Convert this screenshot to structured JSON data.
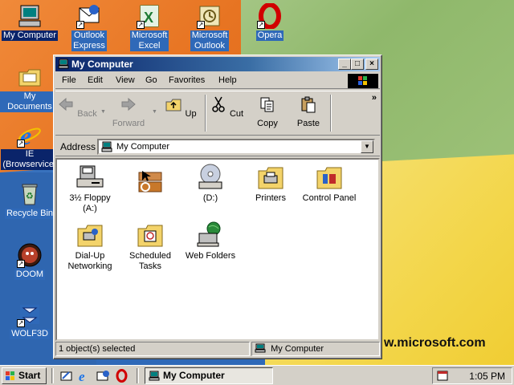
{
  "desktop": {
    "icons": [
      {
        "label": "My Computer"
      },
      {
        "label": "Outlook\nExpress"
      },
      {
        "label": "Microsoft\nExcel"
      },
      {
        "label": "Microsoft\nOutlook"
      },
      {
        "label": "Opera"
      },
      {
        "label": "My Documents"
      },
      {
        "label": "IE\n(Browservice)"
      },
      {
        "label": "Recycle Bin"
      },
      {
        "label": "DOOM"
      },
      {
        "label": "WOLF3D"
      }
    ],
    "wallpaper_text": "w.microsoft.com"
  },
  "window": {
    "title": "My Computer",
    "caption_buttons": {
      "minimize": "_",
      "maximize": "□",
      "close": "×"
    },
    "menu": {
      "file": "File",
      "edit": "Edit",
      "view": "View",
      "go": "Go",
      "favorites": "Favorites",
      "help": "Help"
    },
    "toolbar": {
      "back": "Back",
      "forward": "Forward",
      "up": "Up",
      "cut": "Cut",
      "copy": "Copy",
      "paste": "Paste",
      "more": "»"
    },
    "address": {
      "label": "Address",
      "value": "My Computer"
    },
    "items": [
      {
        "label": "3½ Floppy\n(A:)"
      },
      {
        "label": ""
      },
      {
        "label": "(D:)"
      },
      {
        "label": "Printers"
      },
      {
        "label": "Control Panel"
      },
      {
        "label": "Dial-Up\nNetworking"
      },
      {
        "label": "Scheduled\nTasks"
      },
      {
        "label": "Web Folders"
      }
    ],
    "status": {
      "left": "1 object(s) selected",
      "right": "My Computer"
    }
  },
  "taskbar": {
    "start": "Start",
    "task_button": "My Computer",
    "clock": "1:05 PM"
  },
  "colors": {
    "title_active": "#0a246a",
    "face": "#d4d0c8",
    "desktop": "#3a6ea5"
  }
}
